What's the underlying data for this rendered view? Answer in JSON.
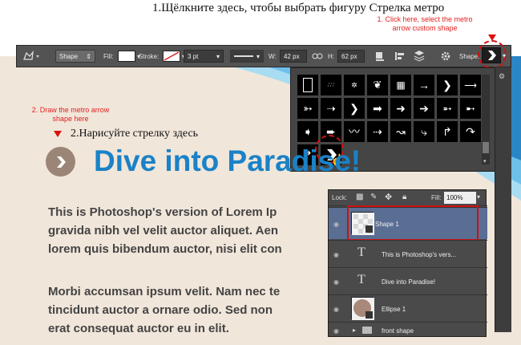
{
  "captions": {
    "step1_ru": "1.Щёлкните здесь, чтобы выбрать фигуру Стрелка метро",
    "step1_en": "1. Click here, select the metro arrow custom shape",
    "step2_en": "2. Draw the metro arrow shape here",
    "step2_ru": "2.Нарисуйте стрелку здесь"
  },
  "toolbar": {
    "mode": "Shape",
    "fill_label": "Fill:",
    "stroke_label": "Stroke:",
    "stroke_width": "3 pt",
    "w_label": "W:",
    "w_value": "42 px",
    "h_label": "H:",
    "h_value": "62 px",
    "shape_label": "Shape:"
  },
  "page": {
    "title": "Dive into Paradise!",
    "paragraph1": [
      "This is Photoshop's version  of Lorem Ip",
      "gravida nibh vel velit auctor aliquet. Aen",
      "lorem quis bibendum auctor, nisi elit con"
    ],
    "paragraph2": [
      "Morbi accumsan ipsum velit. Nam nec te",
      "tincidunt auctor a ornare odio. Sed non",
      "erat consequat auctor eu in elit."
    ]
  },
  "layers": {
    "lock_label": "Lock:",
    "fill_label": "Fill:",
    "fill_value": "100%",
    "items": [
      {
        "name": "Shape 1",
        "kind": "shape",
        "selected": true
      },
      {
        "name": "This is Photoshop's vers...",
        "kind": "text",
        "selected": false
      },
      {
        "name": "Dive into Paradise!",
        "kind": "text",
        "selected": false
      },
      {
        "name": "Ellipse 1",
        "kind": "ellipse",
        "selected": false
      },
      {
        "name": "front shape",
        "kind": "group",
        "selected": false
      }
    ]
  },
  "colors": {
    "accent_red": "#e01010",
    "title_blue": "#1a82c7",
    "layer_selected": "#5a6e94"
  }
}
